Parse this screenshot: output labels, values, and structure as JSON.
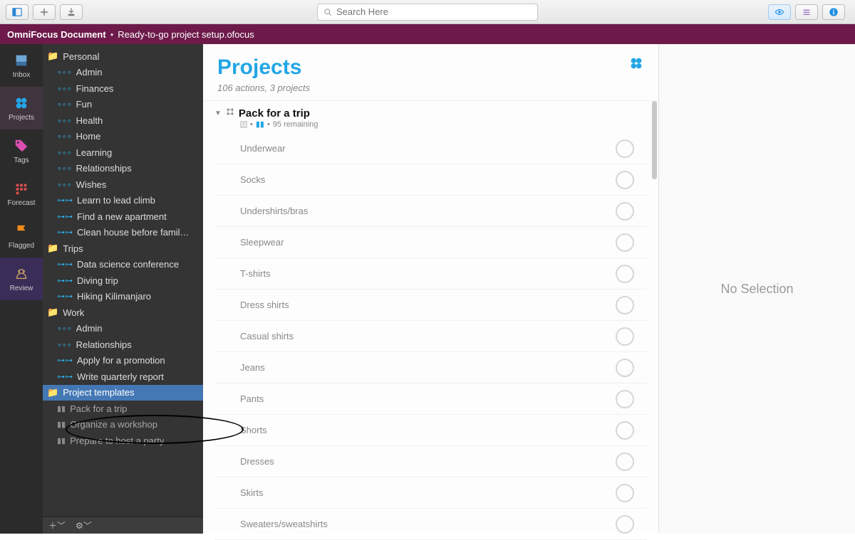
{
  "toolbar": {
    "search_placeholder": "Search Here"
  },
  "titlebar": {
    "document": "OmniFocus Document",
    "filename": "Ready-to-go project setup.ofocus"
  },
  "nav": {
    "inbox": "Inbox",
    "projects": "Projects",
    "tags": "Tags",
    "forecast": "Forecast",
    "flagged": "Flagged",
    "review": "Review"
  },
  "outline": {
    "personal": "Personal",
    "personal_items": [
      "Admin",
      "Finances",
      "Fun",
      "Health",
      "Home",
      "Learning",
      "Relationships",
      "Wishes",
      "Learn to lead climb",
      "Find a new apartment",
      "Clean house before famil…"
    ],
    "trips": "Trips",
    "trips_items": [
      "Data science conference",
      "Diving trip",
      "Hiking Kilimanjaro"
    ],
    "work": "Work",
    "work_items": [
      "Admin",
      "Relationships",
      "Apply for a promotion",
      "Write quarterly report"
    ],
    "templates": "Project templates",
    "template_items": [
      "Pack for a trip",
      "Organize a workshop",
      "Prepare to host a party"
    ]
  },
  "main": {
    "title": "Projects",
    "subtitle": "106 actions, 3 projects",
    "project": {
      "title": "Pack for a trip",
      "remaining": "95 remaining"
    },
    "tasks": [
      "Underwear",
      "Socks",
      "Undershirts/bras",
      "Sleepwear",
      "T-shirts",
      "Dress shirts",
      "Casual shirts",
      "Jeans",
      "Pants",
      "Shorts",
      "Dresses",
      "Skirts",
      "Sweaters/sweatshirts"
    ]
  },
  "inspector": {
    "empty": "No Selection"
  },
  "colors": {
    "accent": "#23a6e6",
    "purple_bar": "#6d1a4a"
  }
}
